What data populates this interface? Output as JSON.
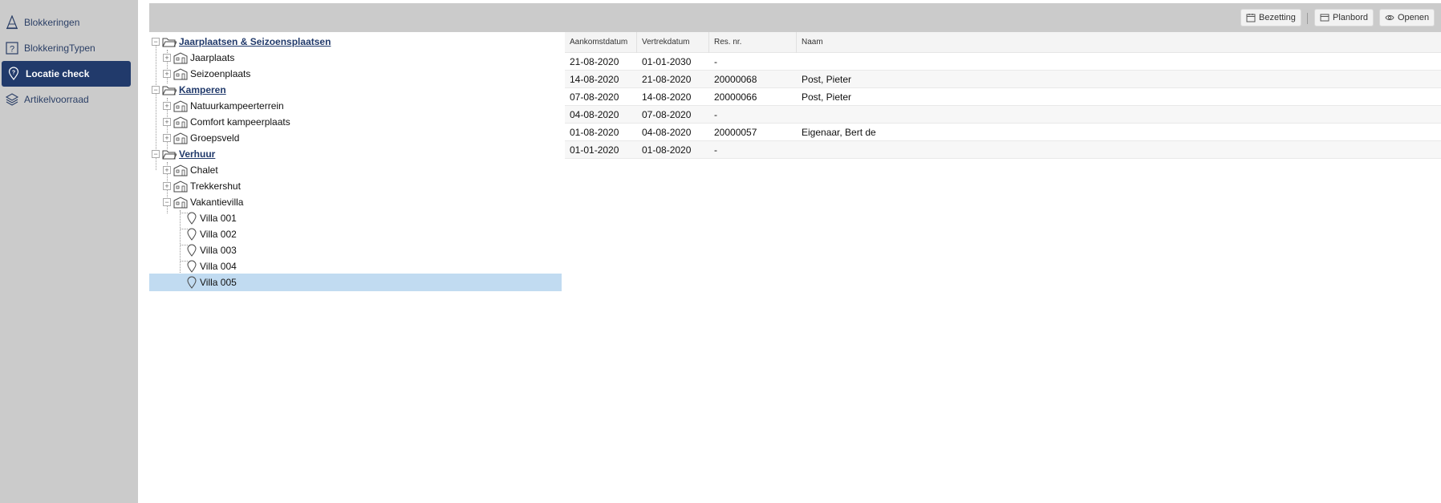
{
  "sidebar": {
    "items": [
      {
        "label": "Blokkeringen",
        "icon": "cone-icon"
      },
      {
        "label": "BlokkeringTypen",
        "icon": "question-box-icon"
      },
      {
        "label": "Locatie check",
        "icon": "location-pin-icon",
        "active": true
      },
      {
        "label": "Artikelvoorraad",
        "icon": "layers-icon"
      }
    ]
  },
  "toolbar": {
    "bezetting_label": "Bezetting",
    "planbord_label": "Planbord",
    "openen_label": "Openen"
  },
  "tree": {
    "groups": [
      {
        "label": "Jaarplaatsen & Seizoensplaatsen",
        "children": [
          "Jaarplaats",
          "Seizoenplaats"
        ]
      },
      {
        "label": "Kamperen",
        "children": [
          "Natuurkampeerterrein",
          "Comfort kampeerplaats",
          "Groepsveld"
        ]
      },
      {
        "label": "Verhuur",
        "children": [
          "Chalet",
          "Trekkershut",
          "Vakantievilla"
        ]
      }
    ],
    "villas": [
      "Villa 001",
      "Villa 002",
      "Villa 003",
      "Villa 004",
      "Villa 005"
    ],
    "selected": "Villa 005"
  },
  "grid": {
    "columns": [
      "Aankomstdatum",
      "Vertrekdatum",
      "Res. nr.",
      "Naam"
    ],
    "rows": [
      [
        "21-08-2020",
        "01-01-2030",
        "-",
        ""
      ],
      [
        "14-08-2020",
        "21-08-2020",
        "20000068",
        "Post, Pieter"
      ],
      [
        "07-08-2020",
        "14-08-2020",
        "20000066",
        "Post, Pieter"
      ],
      [
        "04-08-2020",
        "07-08-2020",
        "-",
        ""
      ],
      [
        "01-08-2020",
        "04-08-2020",
        "20000057",
        "Eigenaar, Bert de"
      ],
      [
        "01-01-2020",
        "01-08-2020",
        "-",
        ""
      ]
    ]
  },
  "colors": {
    "sidebar_bg": "#cbcbcb",
    "active_item": "#213a6b",
    "selected_row": "#c1dbf1"
  }
}
